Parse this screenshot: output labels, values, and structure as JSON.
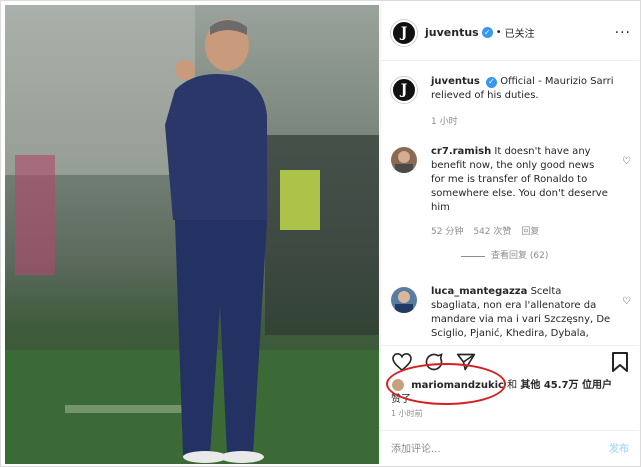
{
  "header": {
    "username": "juventus",
    "verified_icon": "verified-badge-icon",
    "separator": "•",
    "follow_label": "已关注",
    "more_label": "···"
  },
  "caption": {
    "username": "juventus",
    "text": "Official - Maurizio Sarri relieved of his duties.",
    "time": "1 小时"
  },
  "comments": [
    {
      "username": "cr7.ramish",
      "text": "It doesn't have any benefit now, the only good news for me is transfer of Ronaldo to somewhere else. You don't deserve him",
      "time": "52 分钟",
      "likes": "542 次赞",
      "reply": "回复",
      "view_replies": "查看回复 (62)"
    },
    {
      "username": "luca_mantegazza",
      "text": "Scelta sbagliata, non era l'allenatore da mandare via ma i vari Szczęsny, De Sciglio, Pjanić, Khedira, Dybala, Costa..."
    }
  ],
  "likes": {
    "liker": "mariomandzukic",
    "and": "和",
    "others": "其他 45.7万 位用户",
    "suffix": "赞了"
  },
  "post_time": "1 小时前",
  "add_comment": {
    "placeholder": "添加评论...",
    "post_label": "发布"
  },
  "colors": {
    "accent": "#3897f0",
    "annotation": "#d42020"
  }
}
